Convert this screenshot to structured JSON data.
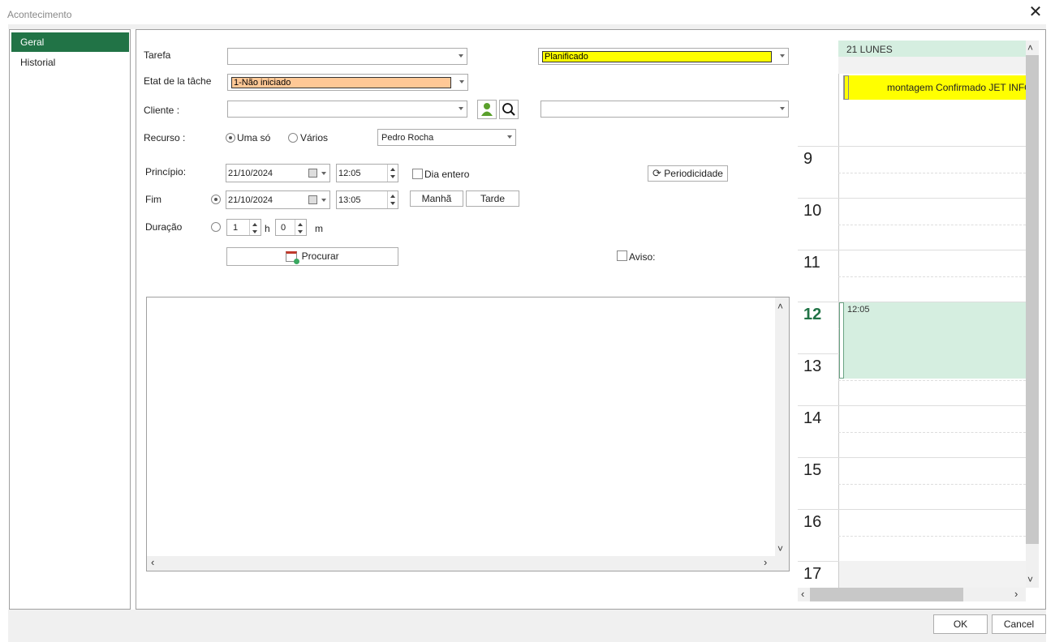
{
  "window": {
    "title": "Acontecimento",
    "close_label": "✕"
  },
  "sidebar": {
    "items": [
      {
        "label": "Geral",
        "selected": true
      },
      {
        "label": "Historial",
        "selected": false
      }
    ]
  },
  "form": {
    "tarefa_label": "Tarefa",
    "tarefa_value": "",
    "status_value": "Planificado",
    "etat_label": "Etat de la tâche",
    "etat_value": "1-Não iniciado",
    "cliente_label": "Cliente :",
    "cliente_value": "",
    "cliente2_value": "",
    "recurso_label": "Recurso :",
    "recurso_opt1": "Uma só",
    "recurso_opt2": "Vários",
    "recurso_value": "Pedro Rocha",
    "principio_label": "Princípio:",
    "principio_date": "21/10/2024",
    "principio_time": "12:05",
    "dia_entero_label": "Dia entero",
    "periodicidade_label": "Periodicidade",
    "fim_label": "Fim",
    "fim_date": "21/10/2024",
    "fim_time": "13:05",
    "manha_label": "Manhã",
    "tarde_label": "Tarde",
    "duracao_label": "Duração",
    "dur_hours": "1",
    "dur_h_unit": "h",
    "dur_minutes": "0",
    "dur_m_unit": "m",
    "procurar_label": "Procurar",
    "aviso_label": "Aviso:",
    "notes": ""
  },
  "colors": {
    "accent": "#217346",
    "status_yellow": "#ffff00",
    "etat_orange": "#ffc896",
    "cal_green": "#d5eee0"
  },
  "calendar": {
    "day_header": "21 LUNES",
    "allday_event": "montagem Confirmado JET INFO",
    "hours": [
      "9",
      "10",
      "11",
      "12",
      "13",
      "14",
      "15",
      "16",
      "17"
    ],
    "current_hour": "12",
    "event_time": "12:05"
  },
  "footer": {
    "ok_label": "OK",
    "cancel_label": "Cancel"
  }
}
